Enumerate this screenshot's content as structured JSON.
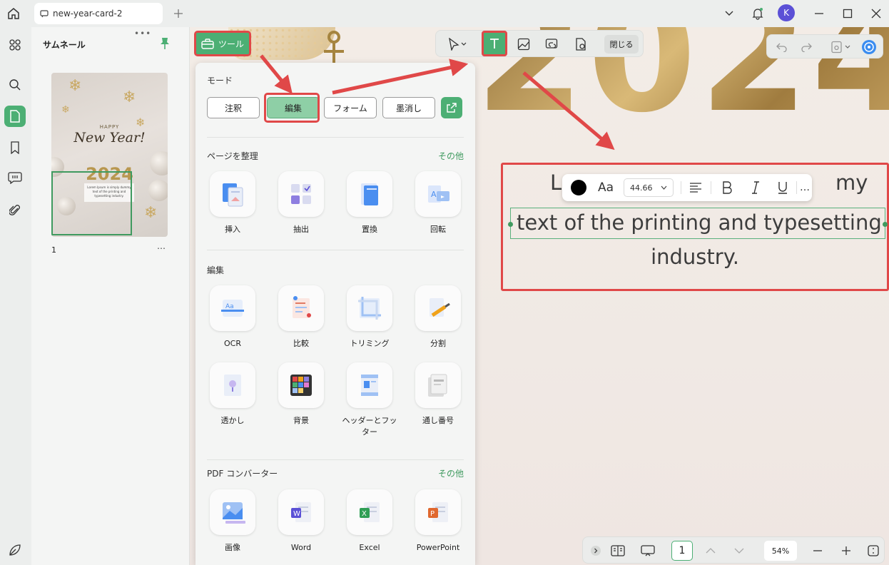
{
  "window": {
    "tab_title": "new-year-card-2",
    "avatar_initial": "K"
  },
  "thumbnails": {
    "title": "サムネール",
    "page_number": "1",
    "more": "…",
    "preview": {
      "happy": "HAPPY",
      "new_year": "New Year!",
      "year": "2024",
      "body": "Lorem Ipsum is simply dummy text of the printing and typesetting industry."
    }
  },
  "tools_button": {
    "label": "ツール"
  },
  "panel": {
    "mode_label": "モード",
    "modes": [
      "注釈",
      "編集",
      "フォーム",
      "墨消し"
    ],
    "active_mode": "編集",
    "organize": {
      "label": "ページを整理",
      "more": "その他",
      "items": [
        "挿入",
        "抽出",
        "置換",
        "回転"
      ]
    },
    "edit": {
      "label": "編集",
      "items": [
        "OCR",
        "比較",
        "トリミング",
        "分割",
        "透かし",
        "背景",
        "ヘッダーとフッター",
        "通し番号"
      ]
    },
    "converter": {
      "label": "PDF コンバーター",
      "more": "その他",
      "items": [
        "画像",
        "Word",
        "Excel",
        "PowerPoint"
      ]
    }
  },
  "float_toolbar": {
    "close_label": "閉じる"
  },
  "document": {
    "big_year": "2024",
    "line1_start": "L",
    "line1_end": "my",
    "line2": "text of the printing and typesetting",
    "line3": "industry."
  },
  "format_bar": {
    "font_icon": "Aa",
    "font_size": "44.66",
    "more": "…"
  },
  "bottom_bar": {
    "page": "1",
    "zoom": "54%"
  },
  "colors": {
    "accent": "#4caf74",
    "highlight": "#e04848",
    "gold": "#b8924f"
  }
}
